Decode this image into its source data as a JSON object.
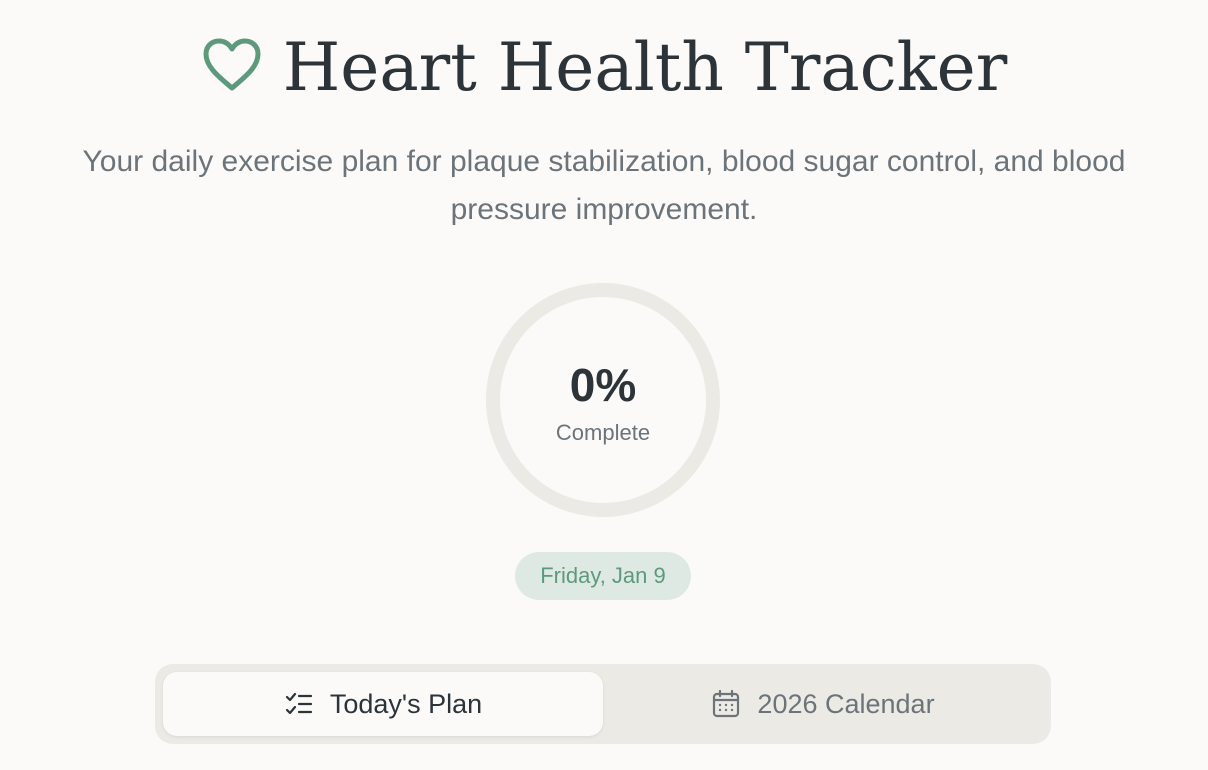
{
  "header": {
    "title": "Heart Health Tracker",
    "icon": "heart-outline-icon"
  },
  "subtitle": "Your daily exercise plan for plaque stabilization, blood sugar control, and blood pressure improvement.",
  "progress": {
    "value_text": "0%",
    "fraction": 0,
    "label": "Complete"
  },
  "date_badge": "Friday, Jan 9",
  "tabs": [
    {
      "label": "Today's Plan",
      "icon": "checklist-icon",
      "active": true
    },
    {
      "label": "2026 Calendar",
      "icon": "calendar-icon",
      "active": false
    }
  ],
  "colors": {
    "background": "#fbfaf8",
    "accent_green": "#5d9a7c",
    "badge_bg": "#dfe9e3",
    "ring_track": "#ebeae5",
    "text_dark": "#2c343a",
    "text_muted": "#6c747a"
  }
}
